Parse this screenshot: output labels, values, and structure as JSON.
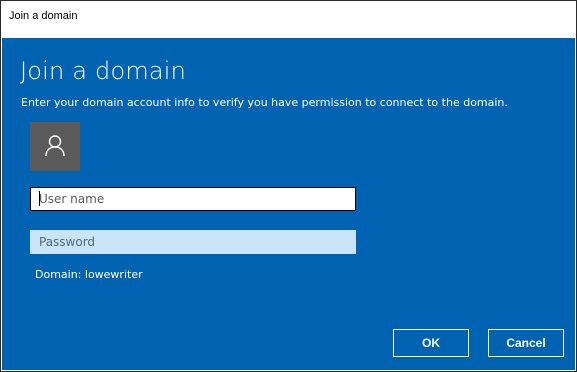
{
  "window": {
    "title": "Join a domain"
  },
  "dialog": {
    "heading": "Join a domain",
    "description": "Enter your domain account info to verify you have permission to connect to the domain.",
    "avatar_icon": "user-icon",
    "username": {
      "value": "",
      "placeholder": "User name"
    },
    "password": {
      "value": "",
      "placeholder": "Password"
    },
    "domain_label": "Domain: lowewriter",
    "buttons": {
      "ok_label": "OK",
      "cancel_label": "Cancel"
    }
  },
  "colors": {
    "accent_blue": "#0063b1",
    "avatar_gray": "#5a5a5a",
    "password_field": "#cce4f7"
  }
}
